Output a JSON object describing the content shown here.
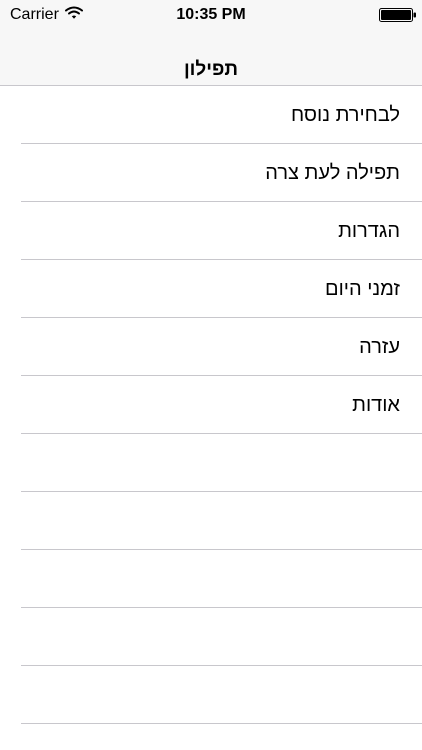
{
  "status_bar": {
    "carrier": "Carrier",
    "time": "10:35 PM",
    "wifi_icon": "wifi-icon",
    "battery_icon": "battery-icon",
    "battery_level": 1.0
  },
  "navigation": {
    "title": "תפילון"
  },
  "menu": {
    "items": [
      {
        "label": "לבחירת נוסח"
      },
      {
        "label": "תפילה לעת צרה"
      },
      {
        "label": "הגדרות"
      },
      {
        "label": "זמני היום"
      },
      {
        "label": "עזרה"
      },
      {
        "label": "אודות"
      }
    ],
    "empty_rows": 5
  },
  "colors": {
    "nav_background": "#f7f7f7",
    "separator": "#c8c7cc",
    "text": "#000000",
    "background": "#ffffff"
  }
}
